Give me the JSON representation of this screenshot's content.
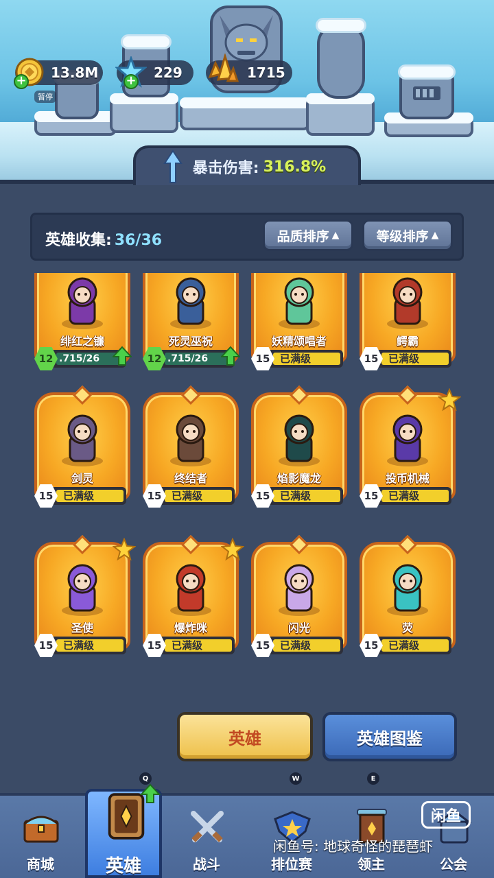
{
  "currencies": [
    {
      "icon": "gold-coin-icon",
      "value": "13.8M"
    },
    {
      "icon": "star-gem-icon",
      "value": "229"
    },
    {
      "icon": "crystal-icon",
      "value": "1715"
    }
  ],
  "pause_label": "暂停",
  "crit": {
    "label": "暴击伤害:",
    "value": "316.8%"
  },
  "collection": {
    "label": "英雄收集:",
    "value": "36/36"
  },
  "sort_buttons": {
    "quality": "品质排序",
    "level": "等级排序"
  },
  "heroes": [
    {
      "name": "绯红之镰",
      "level": "12",
      "status": ".715/26",
      "partial": true,
      "upgrade": true,
      "star": false,
      "color": "#7c3aa8"
    },
    {
      "name": "死灵巫祝",
      "level": "12",
      "status": ".715/26",
      "partial": true,
      "upgrade": true,
      "star": false,
      "color": "#3a5f9a"
    },
    {
      "name": "妖精颂唱者",
      "level": "15",
      "status": "已满级",
      "partial": false,
      "upgrade": false,
      "star": false,
      "color": "#5fc69a"
    },
    {
      "name": "鳄霸",
      "level": "15",
      "status": "已满级",
      "partial": false,
      "upgrade": false,
      "star": false,
      "color": "#b23a2a"
    },
    {
      "name": "剑灵",
      "level": "15",
      "status": "已满级",
      "partial": false,
      "upgrade": false,
      "star": false,
      "color": "#6a5a86"
    },
    {
      "name": "终结者",
      "level": "15",
      "status": "已满级",
      "partial": false,
      "upgrade": false,
      "star": false,
      "color": "#6b4a3a"
    },
    {
      "name": "焰影魔龙",
      "level": "15",
      "status": "已满级",
      "partial": false,
      "upgrade": false,
      "star": false,
      "color": "#1f4a4a"
    },
    {
      "name": "投币机械",
      "level": "15",
      "status": "已满级",
      "partial": false,
      "upgrade": false,
      "star": true,
      "color": "#5a3aa8"
    },
    {
      "name": "圣使",
      "level": "15",
      "status": "已满级",
      "partial": false,
      "upgrade": false,
      "star": true,
      "color": "#8a5ad8"
    },
    {
      "name": "爆炸咪",
      "level": "15",
      "status": "已满级",
      "partial": false,
      "upgrade": false,
      "star": true,
      "color": "#c23a2a"
    },
    {
      "name": "闪光",
      "level": "15",
      "status": "已满级",
      "partial": false,
      "upgrade": false,
      "star": false,
      "color": "#c9a8e8"
    },
    {
      "name": "荧",
      "level": "15",
      "status": "已满级",
      "partial": false,
      "upgrade": false,
      "star": false,
      "color": "#3ac2c2"
    }
  ],
  "buttons": {
    "hero": "英雄",
    "codex": "英雄图鉴"
  },
  "hotkeys": {
    "q": "Q",
    "w": "W",
    "e": "E"
  },
  "nav": [
    {
      "label": "商城",
      "icon": "shop-chest-icon"
    },
    {
      "label": "英雄",
      "icon": "hero-card-icon"
    },
    {
      "label": "战斗",
      "icon": "crossed-swords-icon"
    },
    {
      "label": "排位赛",
      "icon": "rank-shield-icon"
    },
    {
      "label": "领主",
      "icon": "lord-banner-icon"
    },
    {
      "label": "公会",
      "icon": "guild-icon"
    }
  ],
  "watermark": "闲鱼号: 地球奇怪的琵琶虾",
  "xianyu_logo": "闲鱼"
}
